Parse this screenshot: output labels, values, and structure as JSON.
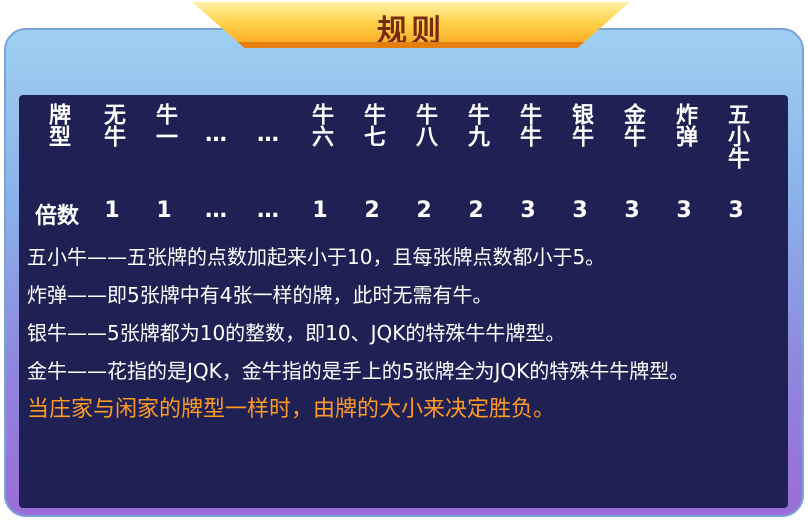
{
  "title": "规则",
  "table": {
    "header_label": "牌型",
    "multiplier_label": "倍数",
    "columns": [
      {
        "name": "无牛",
        "mult": "1"
      },
      {
        "name": "牛一",
        "mult": "1"
      },
      {
        "name": "…",
        "mult": "…"
      },
      {
        "name": "…",
        "mult": "…"
      },
      {
        "name": "牛六",
        "mult": "1"
      },
      {
        "name": "牛七",
        "mult": "2"
      },
      {
        "name": "牛八",
        "mult": "2"
      },
      {
        "name": "牛九",
        "mult": "2"
      },
      {
        "name": "牛牛",
        "mult": "3"
      },
      {
        "name": "银牛",
        "mult": "3"
      },
      {
        "name": "金牛",
        "mult": "3"
      },
      {
        "name": "炸弹",
        "mult": "3"
      },
      {
        "name": "五小牛",
        "mult": "3"
      }
    ]
  },
  "rules": [
    "五小牛——五张牌的点数加起来小于10，且每张牌点数都小于5。",
    "炸弹——即5张牌中有4张一样的牌，此时无需有牛。",
    "银牛——5张牌都为10的整数，即10、JQK的特殊牛牛牌型。",
    "金牛——花指的是JQK，金牛指的是手上的5张牌全为JQK的特殊牛牛牌型。"
  ],
  "highlight": "当庄家与闲家的牌型一样时，由牌的大小来决定胜负。",
  "colors": {
    "panel_bg": "#1f2054",
    "banner": "#ffd24a",
    "highlight": "#ff9a22"
  }
}
